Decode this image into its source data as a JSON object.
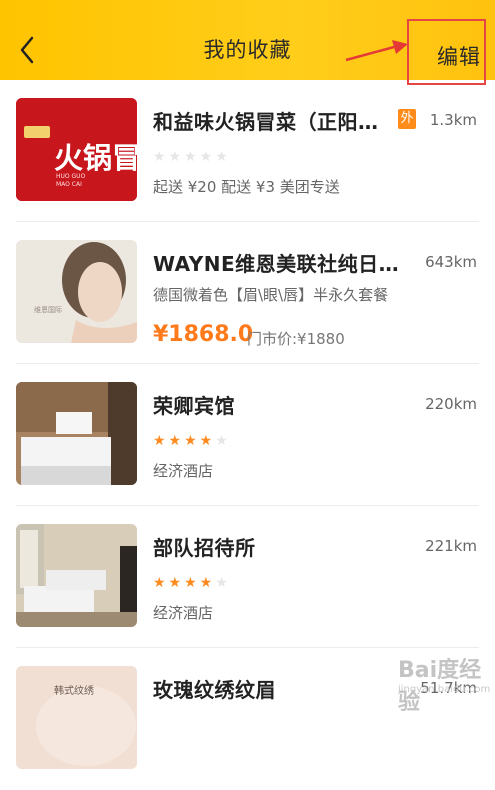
{
  "header": {
    "title": "我的收藏",
    "edit_label": "编辑",
    "back_icon": "chevron-left-icon",
    "background": "#ffc400"
  },
  "favorites": [
    {
      "name": "和益味火锅冒菜（正阳…",
      "badge": "外",
      "distance": "1.3km",
      "rating_stars": 0,
      "info": "起送 ¥20  配送 ¥3  美团专送",
      "thumb_text": "火锅冒菜"
    },
    {
      "name": "WAYNE维恩美联社纯日…",
      "distance": "643km",
      "info": "德国微着色【眉\\眼\\唇】半永久套餐",
      "price": "¥1868.0",
      "original_price": "门市价:¥1880"
    },
    {
      "name": "荣卿宾馆",
      "distance": "220km",
      "rating_stars": 4,
      "info": "经济酒店"
    },
    {
      "name": "部队招待所",
      "distance": "221km",
      "rating_stars": 4,
      "info": "经济酒店"
    },
    {
      "name": "玫瑰纹绣纹眉",
      "distance": "51.7km",
      "thumb_text": "韩式纹绣"
    }
  ],
  "watermark": {
    "main": "Bai度经验",
    "sub": "jingyan.baidu.com"
  },
  "colors": {
    "accent": "#ff7a1a",
    "star": "#ff8a1f",
    "highlight_box": "#e54545"
  }
}
